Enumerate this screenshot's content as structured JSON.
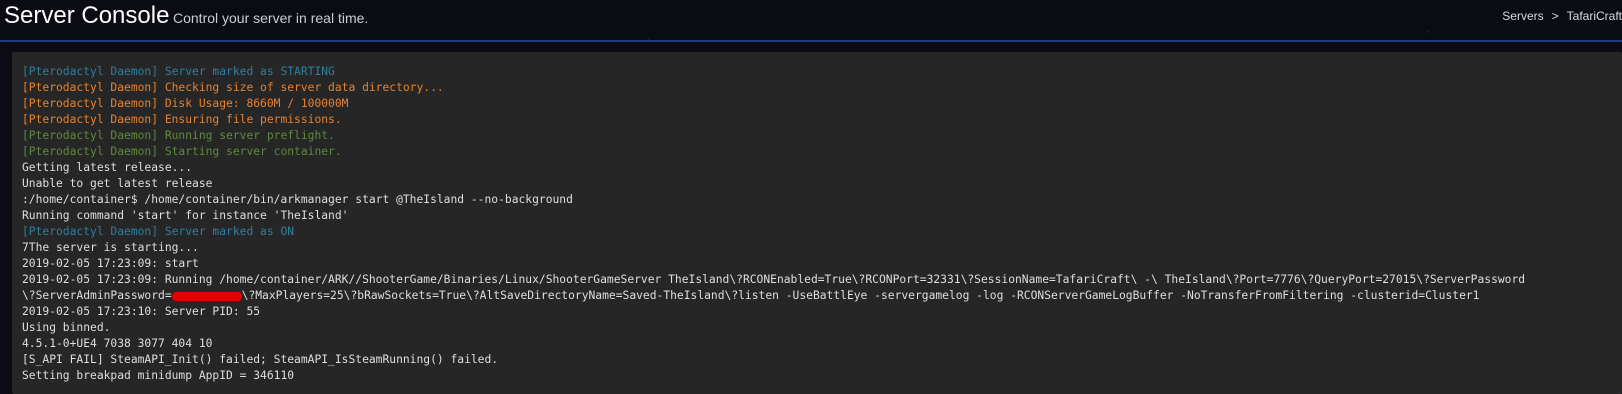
{
  "header": {
    "title": "Server Console",
    "subtitle": "Control your server in real time.",
    "breadcrumb": {
      "servers": "Servers",
      "separator": ">",
      "current": "TafariCraft"
    }
  },
  "colors": {
    "daemon_blue": "#2e7fa0",
    "daemon_orange": "#e8822e",
    "daemon_green": "#5f8a3d",
    "output_text": "#dfdfdf",
    "redaction": "#e00000"
  },
  "console": {
    "lines": [
      {
        "text": "[Pterodactyl Daemon] Server marked as STARTING",
        "color": "#2e7fa0"
      },
      {
        "text": "[Pterodactyl Daemon] Checking size of server data directory...",
        "color": "#e8822e"
      },
      {
        "text": "[Pterodactyl Daemon] Disk Usage: 8660M / 100000M",
        "color": "#e8822e"
      },
      {
        "text": "[Pterodactyl Daemon] Ensuring file permissions.",
        "color": "#e8822e"
      },
      {
        "text": "[Pterodactyl Daemon] Running server preflight.",
        "color": "#5f8a3d"
      },
      {
        "text": "[Pterodactyl Daemon] Starting server container.",
        "color": "#5f8a3d"
      },
      {
        "text": "Getting latest release...",
        "color": "#dfdfdf"
      },
      {
        "text": "Unable to get latest release",
        "color": "#dfdfdf"
      },
      {
        "text": ":/home/container$ /home/container/bin/arkmanager start @TheIsland --no-background",
        "color": "#dfdfdf"
      },
      {
        "text": "Running command 'start' for instance 'TheIsland'",
        "color": "#dfdfdf"
      },
      {
        "text": "[Pterodactyl Daemon] Server marked as ON",
        "color": "#2e7fa0"
      },
      {
        "text": "7The server is starting...",
        "color": "#dfdfdf"
      },
      {
        "text": "2019-02-05 17:23:09: start",
        "color": "#dfdfdf"
      },
      {
        "text": "2019-02-05 17:23:09: Running /home/container/ARK//ShooterGame/Binaries/Linux/ShooterGameServer TheIsland\\?RCONEnabled=True\\?RCONPort=32331\\?SessionName=TafariCraft\\ -\\ TheIsland\\?Port=7776\\?QueryPort=27015\\?ServerPassword",
        "color": "#dfdfdf"
      },
      {
        "text_before": "\\?ServerAdminPassword=",
        "text_after": "\\?MaxPlayers=25\\?bRawSockets=True\\?AltSaveDirectoryName=Saved-TheIsland\\?listen -UseBattlEye -servergamelog -log -RCONServerGameLogBuffer -NoTransferFromFiltering -clusterid=Cluster1",
        "redacted": true,
        "color": "#dfdfdf"
      },
      {
        "text": "2019-02-05 17:23:10: Server PID: 55",
        "color": "#dfdfdf"
      },
      {
        "text": "Using binned.",
        "color": "#dfdfdf"
      },
      {
        "text": "4.5.1-0+UE4 7038 3077 404 10",
        "color": "#dfdfdf"
      },
      {
        "text": "[S_API FAIL] SteamAPI_Init() failed; SteamAPI_IsSteamRunning() failed.",
        "color": "#dfdfdf"
      },
      {
        "text": "Setting breakpad minidump AppID = 346110",
        "color": "#dfdfdf"
      }
    ]
  }
}
